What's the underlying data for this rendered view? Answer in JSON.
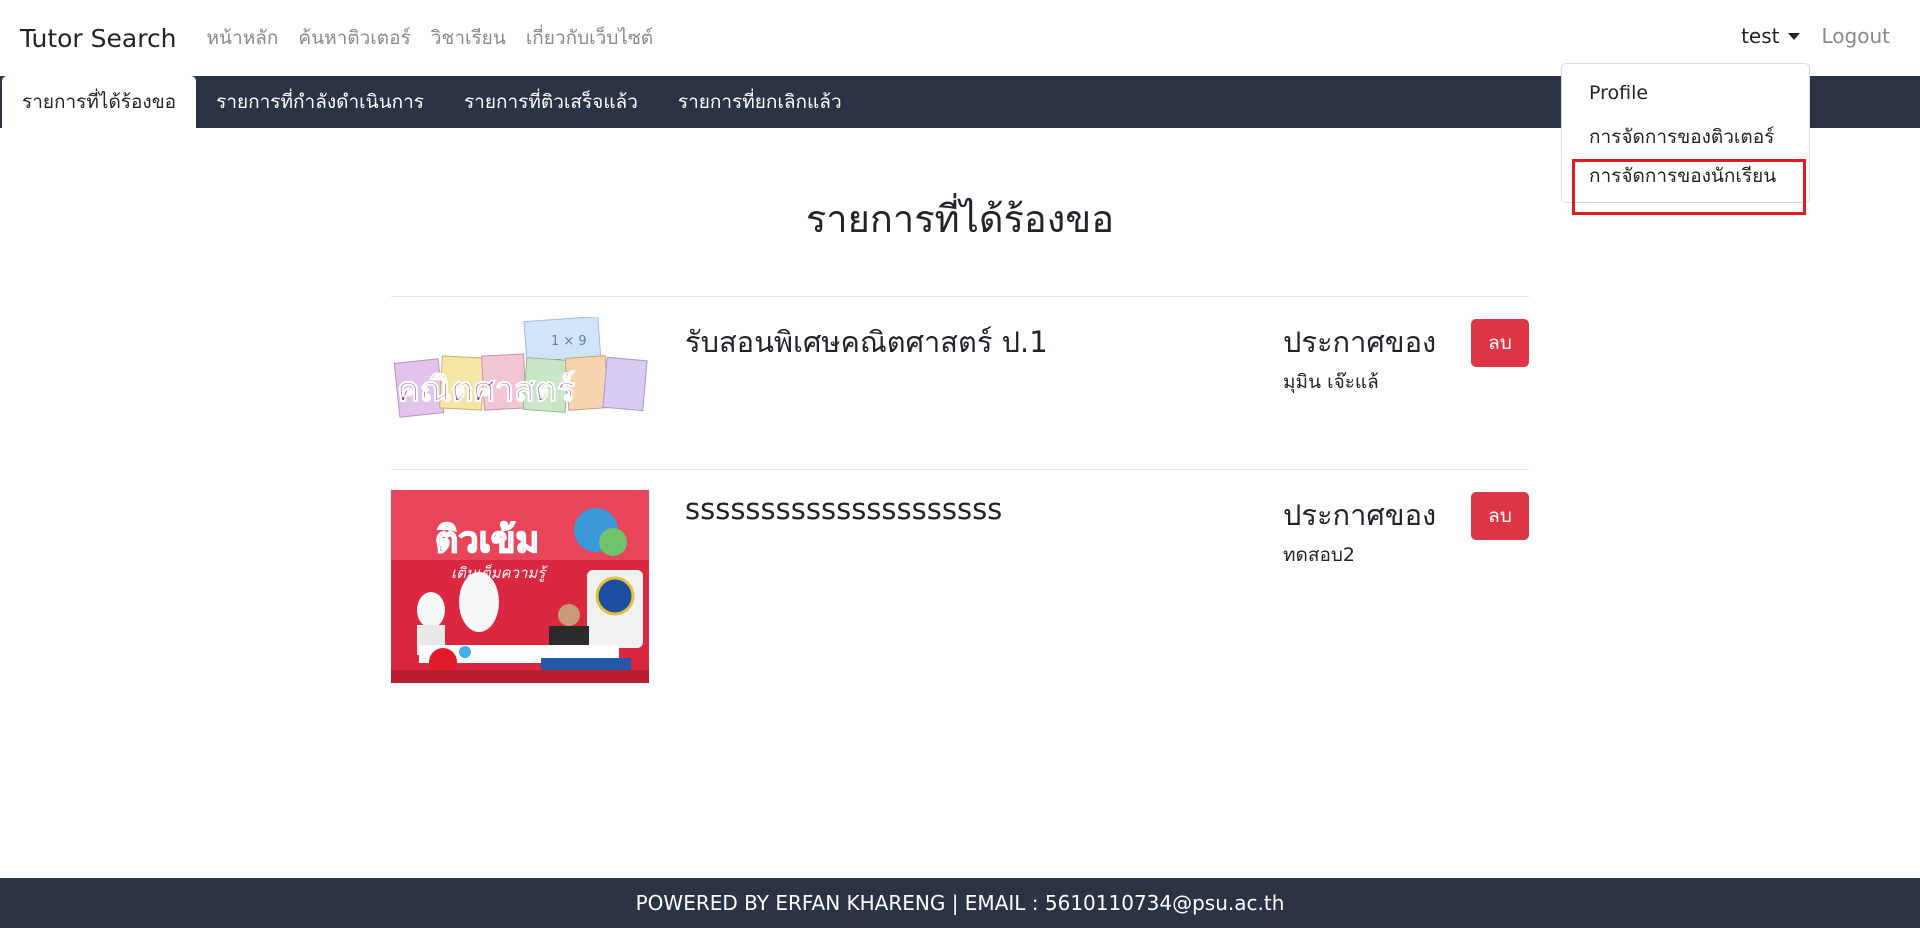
{
  "navbar": {
    "brand": "Tutor Search",
    "links": [
      "หน้าหลัก",
      "ค้นหาติวเตอร์",
      "วิชาเรียน",
      "เกี่ยวกับเว็บไซต์"
    ],
    "user": "test",
    "logout": "Logout"
  },
  "tabs": [
    "รายการที่ได้ร้องขอ",
    "รายการที่กำลังดำเนินการ",
    "รายการที่ติวเสร็จแล้ว",
    "รายการที่ยกเลิกแล้ว"
  ],
  "dropdown": [
    "Profile",
    "การจัดการของติวเตอร์",
    "การจัดการของนักเรียน"
  ],
  "page_title": "รายการที่ได้ร้องขอ",
  "items": [
    {
      "title": "รับสอนพิเศษคณิตศาสตร์ ป.1",
      "announced_label": "ประกาศของ",
      "announcer": "มุมิน เจ๊ะแล้",
      "delete_label": "ลบ",
      "thumb_text": "คณิตศาสตร์"
    },
    {
      "title": "sssssssssssssssssssss",
      "announced_label": "ประกาศของ",
      "announcer": "ทดสอบ2",
      "delete_label": "ลบ",
      "thumb_text": "ติวเข้ม",
      "thumb_subtext": "เติมเต็มความรู้"
    }
  ],
  "footer": "POWERED BY ERFAN KHARENG | EMAIL : 5610110734@psu.ac.th",
  "colors": {
    "dark_bar": "#2b3444",
    "danger": "#dc3545",
    "highlight": "#e11b22"
  }
}
